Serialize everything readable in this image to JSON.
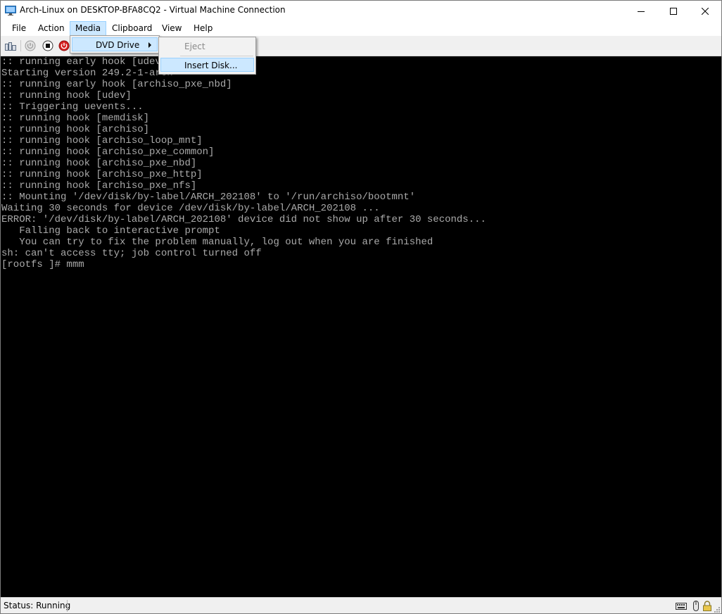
{
  "window": {
    "title": "Arch-Linux on DESKTOP-BFA8CQ2 - Virtual Machine Connection"
  },
  "menubar": {
    "items": [
      "File",
      "Action",
      "Media",
      "Clipboard",
      "View",
      "Help"
    ],
    "open_item": "Media"
  },
  "media_menu": {
    "items": [
      {
        "label": "DVD Drive",
        "has_submenu": true,
        "highlighted": true
      }
    ]
  },
  "dvd_submenu": {
    "items": [
      {
        "label": "Eject",
        "enabled": false
      },
      {
        "label": "Insert Disk...",
        "enabled": true,
        "highlighted": true
      }
    ]
  },
  "toolbar": {
    "icons": [
      "ctrl-alt-del-icon",
      "start-icon",
      "turn-off-icon",
      "shut-down-icon"
    ]
  },
  "console": {
    "lines": [
      ":: running early hook [udev]",
      "Starting version 249.2-1-arch",
      ":: running early hook [archiso_pxe_nbd]",
      ":: running hook [udev]",
      ":: Triggering uevents...",
      ":: running hook [memdisk]",
      ":: running hook [archiso]",
      ":: running hook [archiso_loop_mnt]",
      ":: running hook [archiso_pxe_common]",
      ":: running hook [archiso_pxe_nbd]",
      ":: running hook [archiso_pxe_http]",
      ":: running hook [archiso_pxe_nfs]",
      ":: Mounting '/dev/disk/by-label/ARCH_202108' to '/run/archiso/bootmnt'",
      "Waiting 30 seconds for device /dev/disk/by-label/ARCH_202108 ...",
      "ERROR: '/dev/disk/by-label/ARCH_202108' device did not show up after 30 seconds...",
      "   Falling back to interactive prompt",
      "   You can try to fix the problem manually, log out when you are finished",
      "sh: can't access tty; job control turned off",
      "[rootfs ]# mmm"
    ]
  },
  "statusbar": {
    "status": "Status: Running",
    "icons": [
      "keyboard-icon",
      "mouse-icon",
      "lock-icon"
    ]
  },
  "colors": {
    "console_bg": "#000000",
    "console_text": "#aaaaaa",
    "menu_highlight": "#cce8ff",
    "menu_highlight_border": "#99d1ff"
  }
}
